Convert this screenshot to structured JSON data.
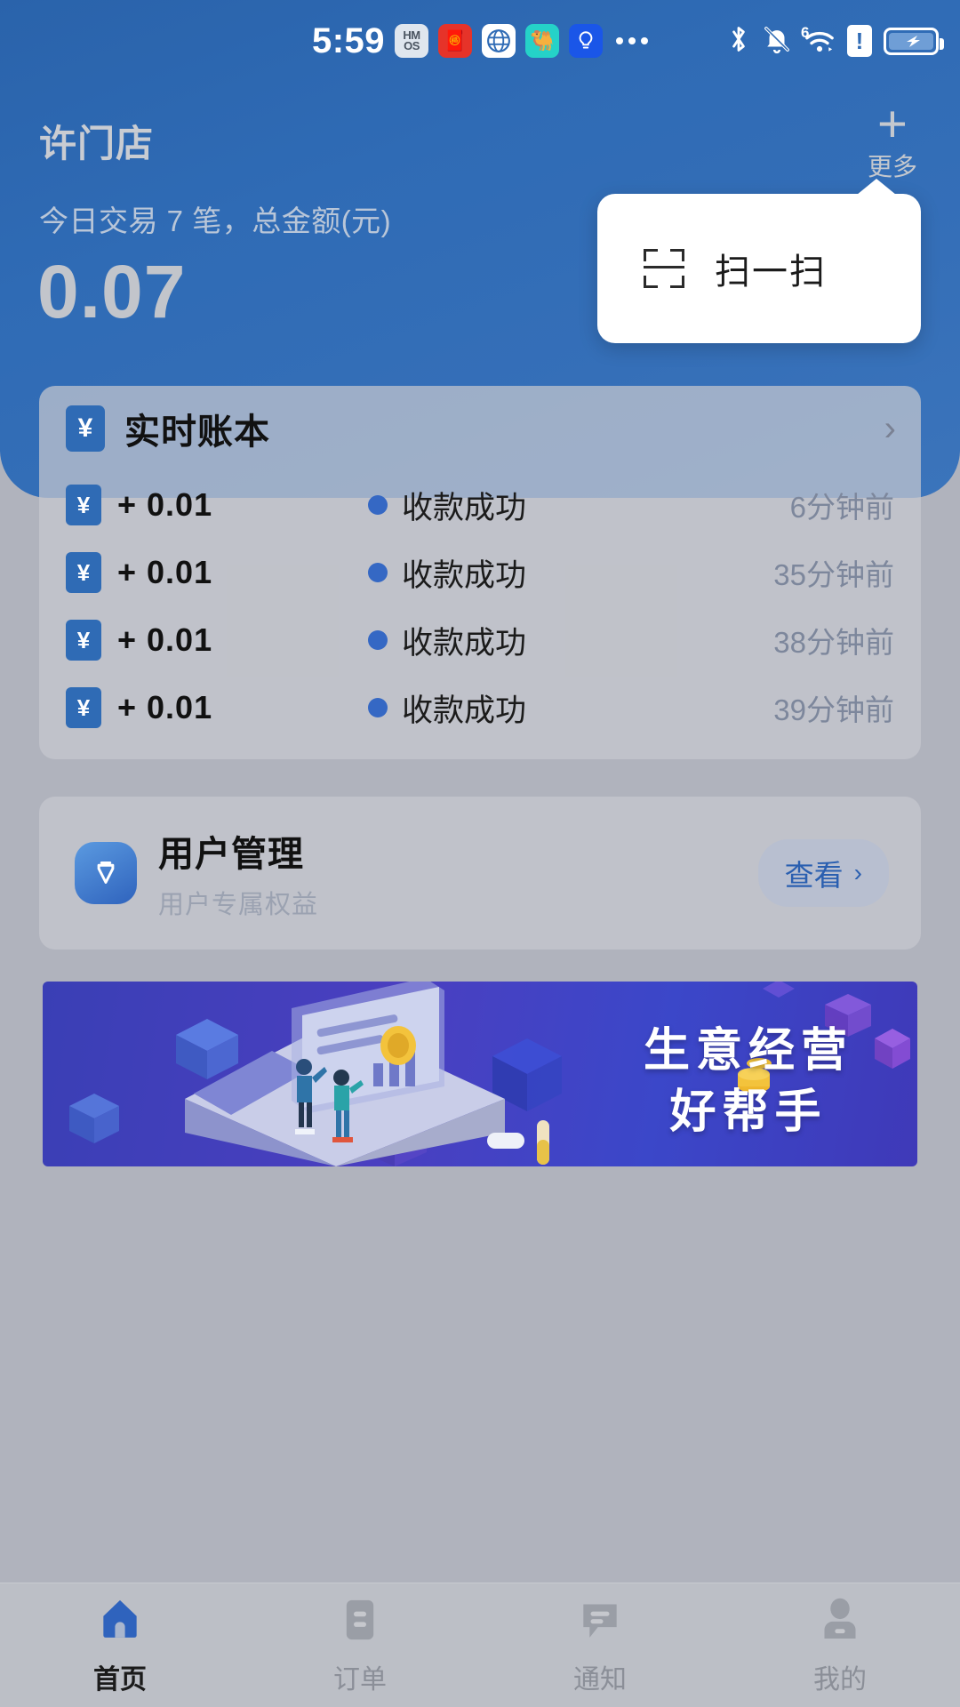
{
  "status_bar": {
    "time": "5:59",
    "app_icons": [
      {
        "name": "hmos-icon",
        "label": "HM\nOS"
      },
      {
        "name": "red-app-icon",
        "label": "🧧"
      },
      {
        "name": "browser-icon",
        "label": "🌐"
      },
      {
        "name": "camel-app-icon",
        "label": "🐫"
      },
      {
        "name": "bulb-app-icon",
        "label": "💡"
      }
    ],
    "overflow": "···",
    "right_icons": [
      "bluetooth-icon",
      "mute-bell-icon",
      "wifi-6-icon",
      "sim-alert-icon",
      "battery-charging-icon"
    ],
    "wifi_generation": "6",
    "sim_alert": "!"
  },
  "header": {
    "store_name": "许门店",
    "today_summary": "今日交易 7 笔，总金额(元)",
    "amount": "0.07",
    "more_label": "更多",
    "more_plus": "+",
    "accent_color": "#2f6bb5"
  },
  "scan_popup": {
    "label": "扫一扫"
  },
  "ledger": {
    "title": "实时账本",
    "badge": "¥",
    "chevron": "›",
    "transactions": [
      {
        "badge": "¥",
        "amount": "+ 0.01",
        "status": "收款成功",
        "time": "6分钟前"
      },
      {
        "badge": "¥",
        "amount": "+ 0.01",
        "status": "收款成功",
        "time": "35分钟前"
      },
      {
        "badge": "¥",
        "amount": "+ 0.01",
        "status": "收款成功",
        "time": "38分钟前"
      },
      {
        "badge": "¥",
        "amount": "+ 0.01",
        "status": "收款成功",
        "time": "39分钟前"
      }
    ]
  },
  "user_management": {
    "title": "用户管理",
    "subtitle": "用户专属权益",
    "view_label": "查看",
    "view_chevron": "›"
  },
  "banner": {
    "line1": "生意经营",
    "line2": "好帮手"
  },
  "tabbar": {
    "tabs": [
      {
        "name": "home",
        "label": "首页",
        "active": true
      },
      {
        "name": "orders",
        "label": "订单",
        "active": false
      },
      {
        "name": "notifications",
        "label": "通知",
        "active": false
      },
      {
        "name": "profile",
        "label": "我的",
        "active": false
      }
    ],
    "active_color": "#2f63bd",
    "inactive_color": "#8b8f98"
  }
}
